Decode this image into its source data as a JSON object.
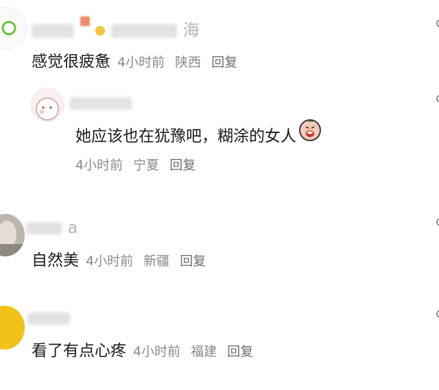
{
  "comments": [
    {
      "username_visible": "海",
      "text": "感觉很疲惫",
      "time": "4小时前",
      "location": "陕西",
      "reply": "回复"
    },
    {
      "text": "她应该也在犹豫吧，糊涂的女人",
      "time": "4小时前",
      "location": "宁夏",
      "reply": "回复",
      "emoji": "crying-face-emoji"
    },
    {
      "username_visible": "a",
      "text": "自然美",
      "time": "4小时前",
      "location": "新疆",
      "reply": "回复"
    },
    {
      "text": "看了有点心疼",
      "time": "4小时前",
      "location": "福建",
      "reply": "回复"
    }
  ],
  "colors": {
    "text": "#1a1a1a",
    "meta": "#8a8a8a",
    "username": "#b5b5b5",
    "avatar_ring": "#6bbf3f",
    "avatar_yellow": "#f2c21a"
  }
}
